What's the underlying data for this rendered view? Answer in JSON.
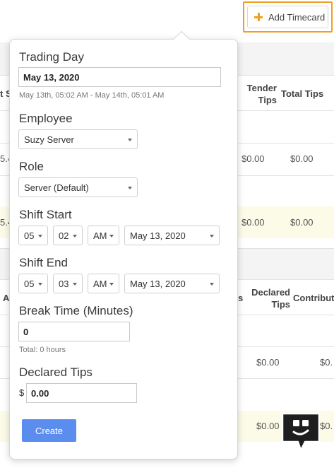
{
  "toolbar": {
    "add_timecard_label": "Add Timecard"
  },
  "background": {
    "col_trunc_1": "t S",
    "tender_tips": "Tender\nTips",
    "total_tips": "Total Tips",
    "row1": {
      "left": "5.4",
      "tender": "$0.00",
      "total": "$0.00"
    },
    "row2": {
      "left": "5.4",
      "tender": "$0.00",
      "total": "$0.00"
    },
    "col_trunc_2": "A",
    "col_trunc_3": "s",
    "declared_tips": "Declared\nTips",
    "contribution": "Contributi",
    "row3": {
      "declared": "$0.00",
      "contrib": "$0."
    },
    "row4": {
      "declared": "$0.00",
      "contrib": "$0."
    }
  },
  "form": {
    "trading_day": {
      "label": "Trading Day",
      "value": "May 13, 2020",
      "hint": "May 13th, 05:02 AM - May 14th, 05:01 AM"
    },
    "employee": {
      "label": "Employee",
      "value": "Suzy Server"
    },
    "role": {
      "label": "Role",
      "value": "Server (Default)"
    },
    "shift_start": {
      "label": "Shift Start",
      "hour": "05",
      "minute": "02",
      "ampm": "AM",
      "date": "May 13, 2020"
    },
    "shift_end": {
      "label": "Shift End",
      "hour": "05",
      "minute": "03",
      "ampm": "AM",
      "date": "May 13, 2020"
    },
    "break_time": {
      "label": "Break Time (Minutes)",
      "value": "0",
      "hint": "Total: 0 hours"
    },
    "declared_tips": {
      "label": "Declared Tips",
      "currency": "$",
      "value": "0.00"
    },
    "create_label": "Create"
  },
  "icons": {
    "add": "plus-icon",
    "chat": "chat-bot-icon"
  },
  "colors": {
    "accent_orange": "#f0a020",
    "primary_blue": "#5b8def",
    "highlight_row": "#fcfbe8"
  }
}
